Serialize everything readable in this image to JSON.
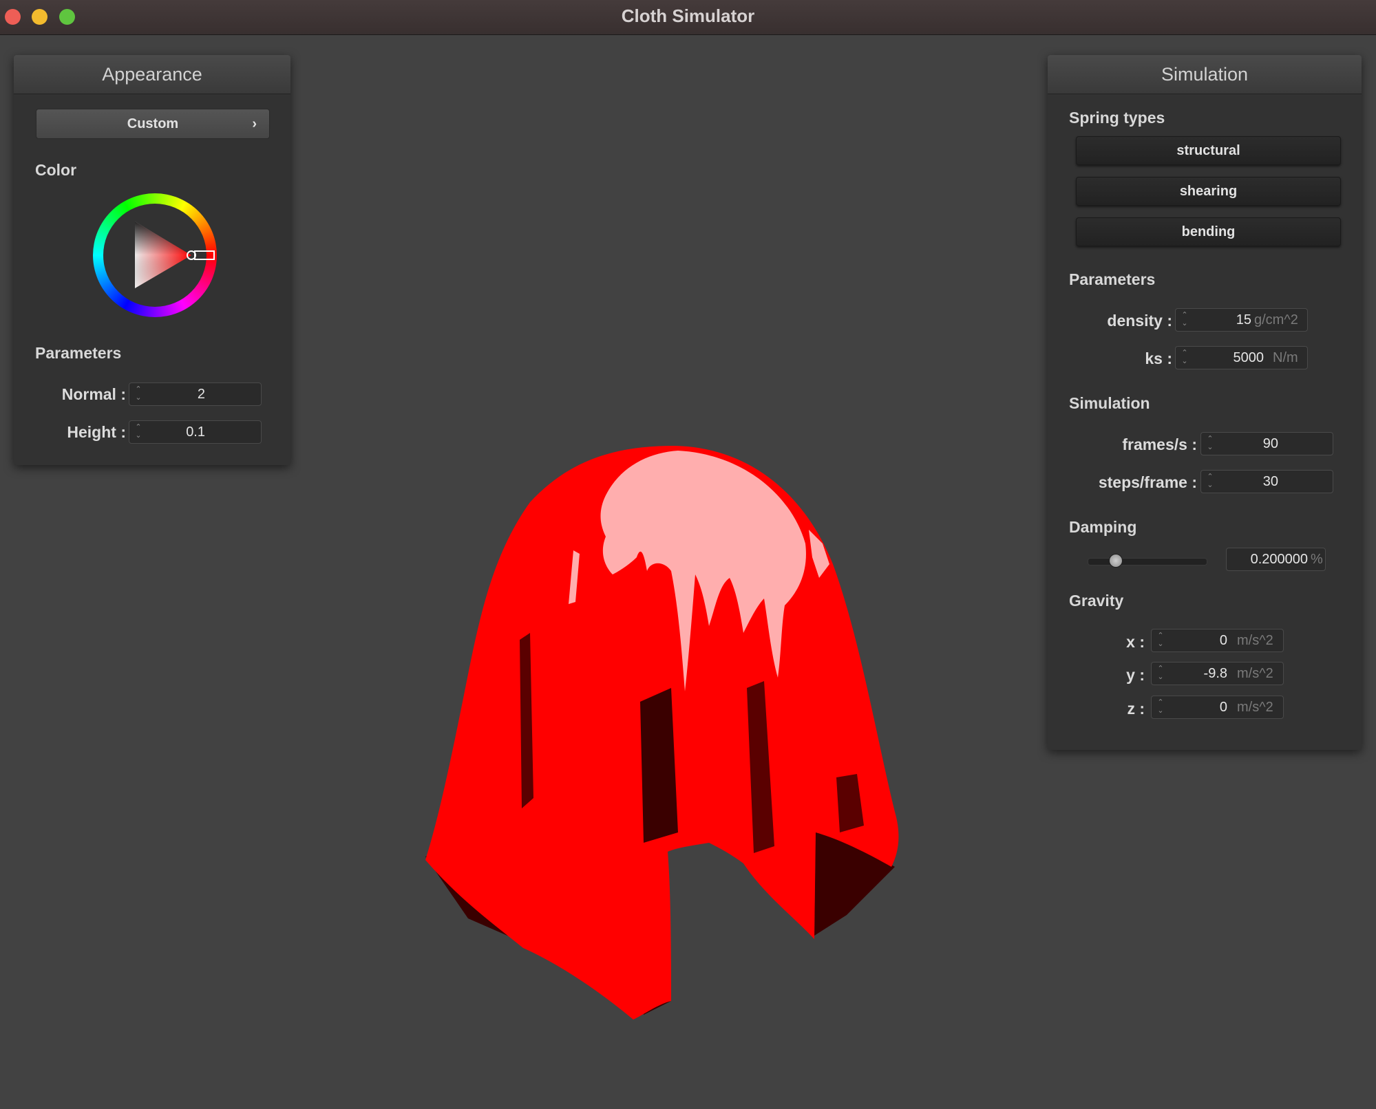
{
  "window": {
    "title": "Cloth Simulator"
  },
  "appearance": {
    "header": "Appearance",
    "shader_dropdown": {
      "value": "Custom"
    },
    "color_label": "Color",
    "selected_color": "#ff0000",
    "parameters_label": "Parameters",
    "normal": {
      "label": "Normal :",
      "value": "2"
    },
    "height": {
      "label": "Height :",
      "value": "0.1"
    }
  },
  "simulation": {
    "header": "Simulation",
    "spring_types_label": "Spring types",
    "spring_buttons": [
      "structural",
      "shearing",
      "bending"
    ],
    "parameters_label": "Parameters",
    "density": {
      "label": "density :",
      "value": "15",
      "unit": "g/cm^2"
    },
    "ks": {
      "label": "ks :",
      "value": "5000",
      "unit": "N/m"
    },
    "simulation_label": "Simulation",
    "frames_per_s": {
      "label": "frames/s :",
      "value": "90"
    },
    "steps_per_frame": {
      "label": "steps/frame :",
      "value": "30"
    },
    "damping_label": "Damping",
    "damping": {
      "value": "0.200000",
      "unit": "%",
      "slider_fraction": 0.2
    },
    "gravity_label": "Gravity",
    "gravity": {
      "x": {
        "label": "x :",
        "value": "0",
        "unit": "m/s^2"
      },
      "y": {
        "label": "y :",
        "value": "-9.8",
        "unit": "m/s^2"
      },
      "z": {
        "label": "z :",
        "value": "0",
        "unit": "m/s^2"
      }
    }
  },
  "scene": {
    "cloth_color": "#ff0000",
    "shadow_color": "#3a0000",
    "highlight_color": "#ffaeae",
    "background_color": "#424242"
  }
}
